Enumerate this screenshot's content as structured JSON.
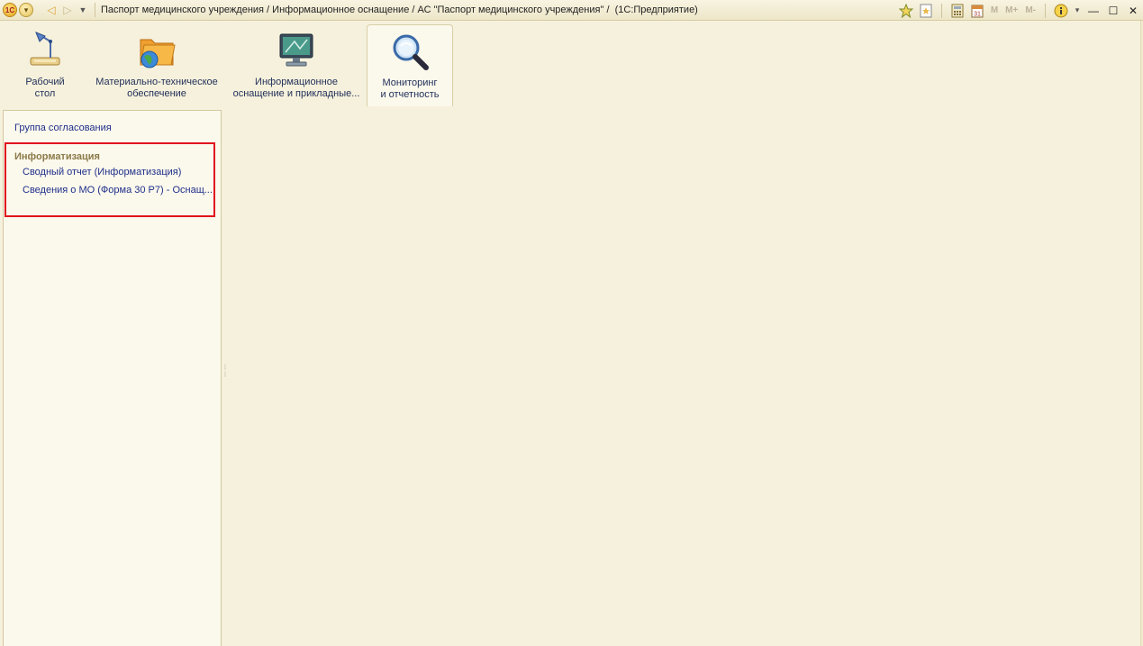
{
  "window": {
    "title": "Паспорт медицинского учреждения / Информационное оснащение / АС \"Паспорт медицинского учреждения\" /  (1С:Предприятие)",
    "logo_text": "1С",
    "toolbar_m": "M",
    "toolbar_mplus": "M+",
    "toolbar_mminus": "M-"
  },
  "sections": [
    {
      "label_line1": "Рабочий",
      "label_line2": "стол",
      "icon": "desk-lamp-icon"
    },
    {
      "label_line1": "Материально-техническое",
      "label_line2": "обеспечение",
      "icon": "folder-globe-icon"
    },
    {
      "label_line1": "Информационное",
      "label_line2": "оснащение и прикладные...",
      "icon": "monitor-icon"
    },
    {
      "label_line1": "Мониторинг",
      "label_line2": "и отчетность",
      "icon": "magnifier-icon"
    }
  ],
  "active_section": 3,
  "nav": {
    "top_item": "Группа согласования",
    "group_title": "Информатизация",
    "items": [
      "Сводный отчет (Информатизация)",
      "Сведения о МО (Форма 30 Р7) - Оснащ..."
    ]
  },
  "colors": {
    "highlight": "#e0141c",
    "link": "#1f2f8a",
    "group": "#8b7a48",
    "background": "#f6f1dc"
  }
}
